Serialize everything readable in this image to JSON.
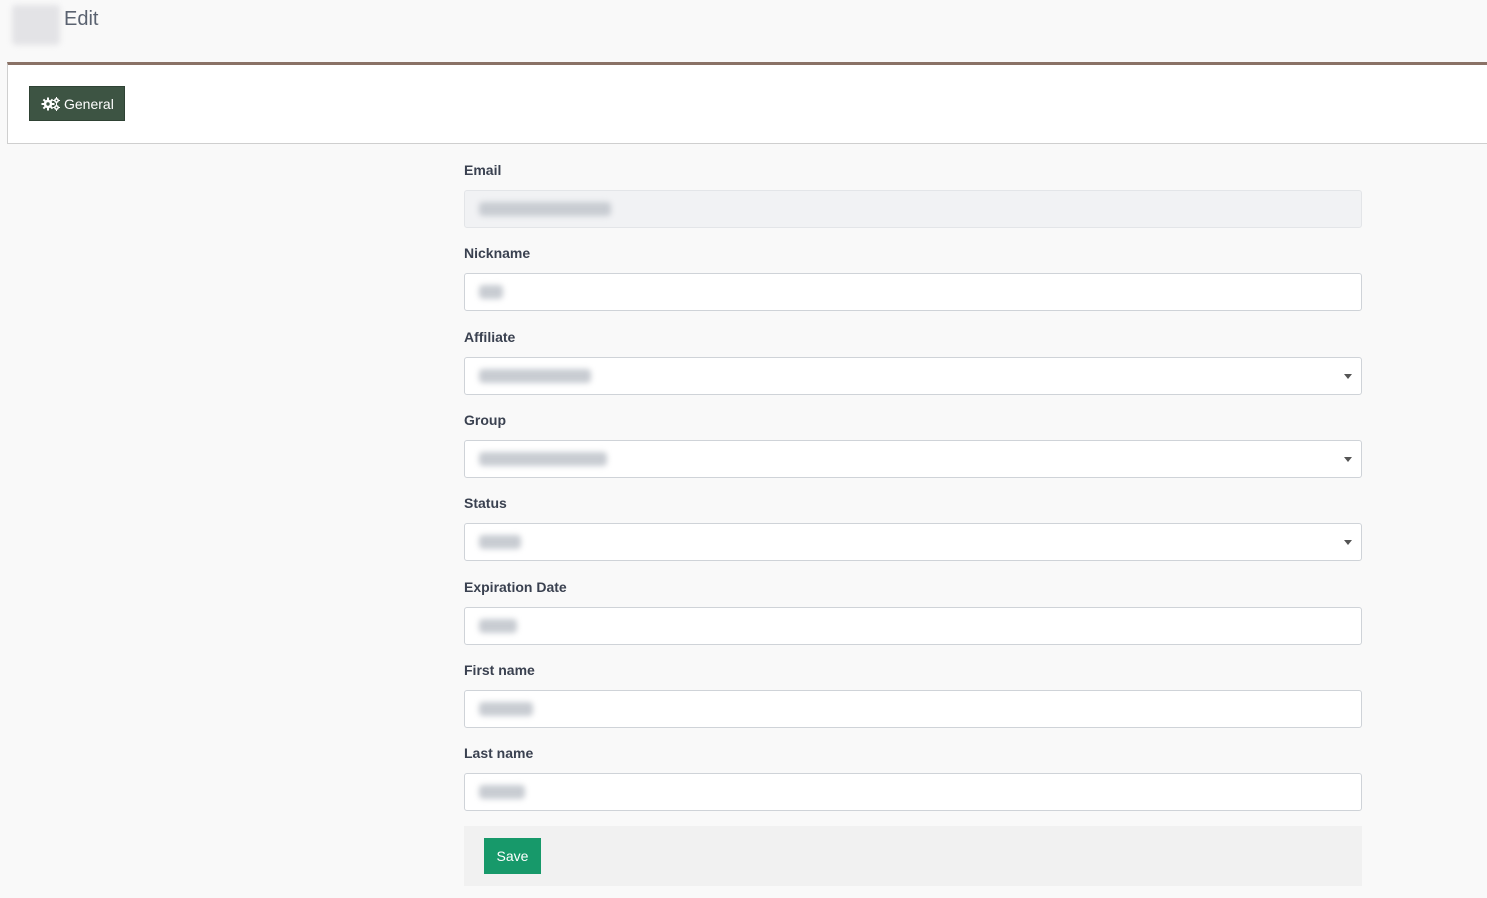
{
  "header": {
    "title": "Edit"
  },
  "tabs": [
    {
      "label": "General",
      "icon": "gears-icon",
      "active": true
    }
  ],
  "form": {
    "fields": [
      {
        "label": "Email",
        "type": "text",
        "disabled": true
      },
      {
        "label": "Nickname",
        "type": "text"
      },
      {
        "label": "Affiliate",
        "type": "select"
      },
      {
        "label": "Group",
        "type": "select"
      },
      {
        "label": "Status",
        "type": "select"
      },
      {
        "label": "Expiration Date",
        "type": "text"
      },
      {
        "label": "First name",
        "type": "text"
      },
      {
        "label": "Last name",
        "type": "text"
      }
    ],
    "save_label": "Save"
  },
  "colors": {
    "tab_active_bg": "#3d5443",
    "panel_top_border": "#8a7266",
    "save_button_bg": "#17996a"
  }
}
